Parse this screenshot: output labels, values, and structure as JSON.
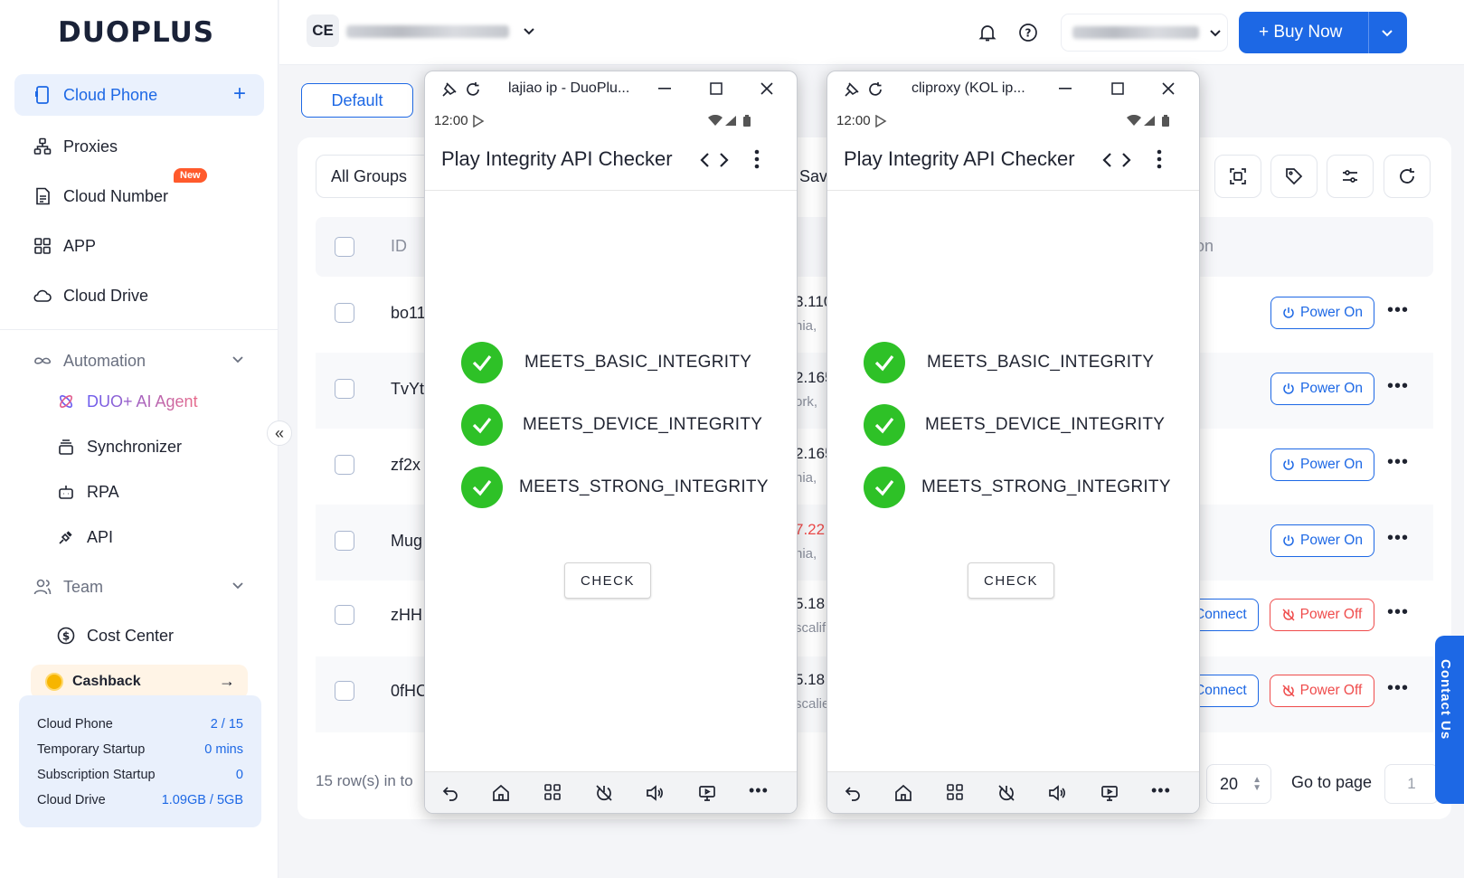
{
  "app": {
    "logo": "DUOPLUS"
  },
  "sidebar": {
    "cloud_phone": "Cloud Phone",
    "proxies": "Proxies",
    "cloud_number": "Cloud Number",
    "new_badge": "New",
    "app": "APP",
    "cloud_drive": "Cloud Drive",
    "automation": "Automation",
    "ai_agent": "DUO+ AI Agent",
    "synchronizer": "Synchronizer",
    "rpa": "RPA",
    "api": "API",
    "team": "Team",
    "cost_center": "Cost Center",
    "cashback": "Cashback",
    "stats": [
      {
        "label": "Cloud Phone",
        "value": "2 / 15"
      },
      {
        "label": "Temporary Startup",
        "value": "0 mins"
      },
      {
        "label": "Subscription Startup",
        "value": "0"
      },
      {
        "label": "Cloud Drive",
        "value": "1.09GB / 5GB"
      }
    ]
  },
  "topbar": {
    "workspace_initials": "CE",
    "buy_now": "+ Buy Now"
  },
  "main": {
    "default_tab": "Default",
    "all_groups": "All Groups",
    "sav_partial": "Sav",
    "col_id": "ID",
    "col_action_partial": "on",
    "rows": [
      {
        "id": "bo11",
        "ip": "3.110",
        "loc": "nia,",
        "ip_color": "#1f2330",
        "action": "Power On",
        "connect": ""
      },
      {
        "id": "TvYt",
        "ip": "2.165",
        "loc": "ork,",
        "ip_color": "#1f2330",
        "action": "Power On",
        "connect": ""
      },
      {
        "id": "zf2x",
        "ip": "2.165",
        "loc": "nia,",
        "ip_color": "#1f2330",
        "action": "Power On",
        "connect": ""
      },
      {
        "id": "Mug",
        "ip": "7.22",
        "loc": "nia,",
        "ip_color": "#ef4b4b",
        "action": "Power On",
        "connect": ""
      },
      {
        "id": "zHH",
        "ip": "5.18",
        "loc": "scalif",
        "ip_color": "#1f2330",
        "action": "Power Off",
        "connect": "Connect"
      },
      {
        "id": "0fHC",
        "ip": "5.18",
        "loc": "scalie",
        "ip_color": "#1f2330",
        "action": "Power Off",
        "connect": "Connect"
      }
    ],
    "rows_text": "15 row(s) in to",
    "page_size": "20",
    "go_to_page": "Go to page",
    "page_input": "1"
  },
  "contact_us": "Contact Us",
  "phones": [
    {
      "window_title": "lajiao ip - DuoPlu...",
      "time": "12:00",
      "app_title": "Play Integrity API Checker",
      "checks": [
        "MEETS_BASIC_INTEGRITY",
        "MEETS_DEVICE_INTEGRITY",
        "MEETS_STRONG_INTEGRITY"
      ],
      "check_button": "CHECK"
    },
    {
      "window_title": "cliproxy  (KOL ip...",
      "time": "12:00",
      "app_title": "Play Integrity API Checker",
      "checks": [
        "MEETS_BASIC_INTEGRITY",
        "MEETS_DEVICE_INTEGRITY",
        "MEETS_STRONG_INTEGRITY"
      ],
      "check_button": "CHECK"
    }
  ],
  "colors": {
    "accent": "#1d68e5",
    "danger": "#ef4b4b",
    "success": "#2ec127"
  }
}
